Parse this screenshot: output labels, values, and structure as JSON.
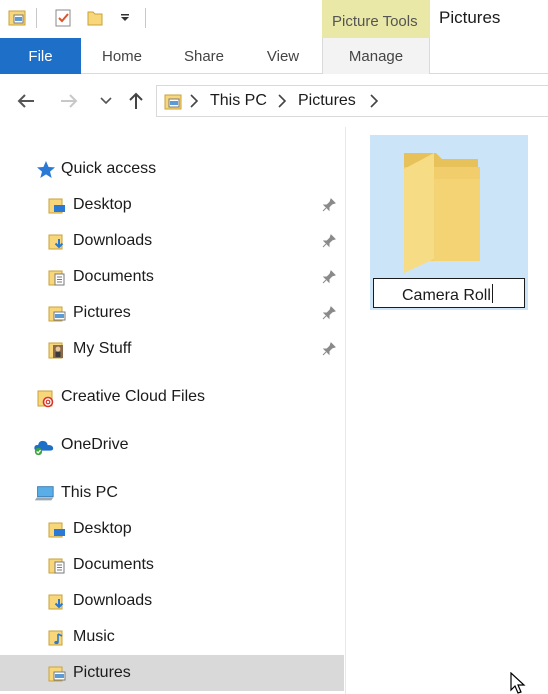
{
  "qat": {
    "icons": [
      "properties-icon",
      "checklist-icon",
      "new-folder-icon",
      "customize-dropdown-icon"
    ]
  },
  "contextual_tab_header": "Picture Tools",
  "window_title": "Pictures",
  "ribbon": {
    "tabs": [
      "File",
      "Home",
      "Share",
      "View",
      "Manage"
    ],
    "active_tab": "File"
  },
  "address_bar": {
    "breadcrumbs": [
      "This PC",
      "Pictures"
    ]
  },
  "nav_pane": {
    "quick_access": {
      "label": "Quick access",
      "items": [
        {
          "label": "Desktop",
          "pinned": true
        },
        {
          "label": "Downloads",
          "pinned": true
        },
        {
          "label": "Documents",
          "pinned": true
        },
        {
          "label": "Pictures",
          "pinned": true
        },
        {
          "label": "My Stuff",
          "pinned": true
        }
      ]
    },
    "creative_cloud": {
      "label": "Creative Cloud Files"
    },
    "onedrive": {
      "label": "OneDrive"
    },
    "this_pc": {
      "label": "This PC",
      "items": [
        {
          "label": "Desktop"
        },
        {
          "label": "Documents"
        },
        {
          "label": "Downloads"
        },
        {
          "label": "Music"
        },
        {
          "label": "Pictures",
          "selected": true
        }
      ]
    }
  },
  "content": {
    "items": [
      {
        "name": "Camera Roll",
        "editing": true
      }
    ]
  },
  "colors": {
    "file_tab": "#1e6fc8",
    "contextual_header": "#e9e8a6",
    "selection_tile": "#cce4f7",
    "nav_selected": "#d9d9d9",
    "folder_yellow": "#f7d77a"
  }
}
